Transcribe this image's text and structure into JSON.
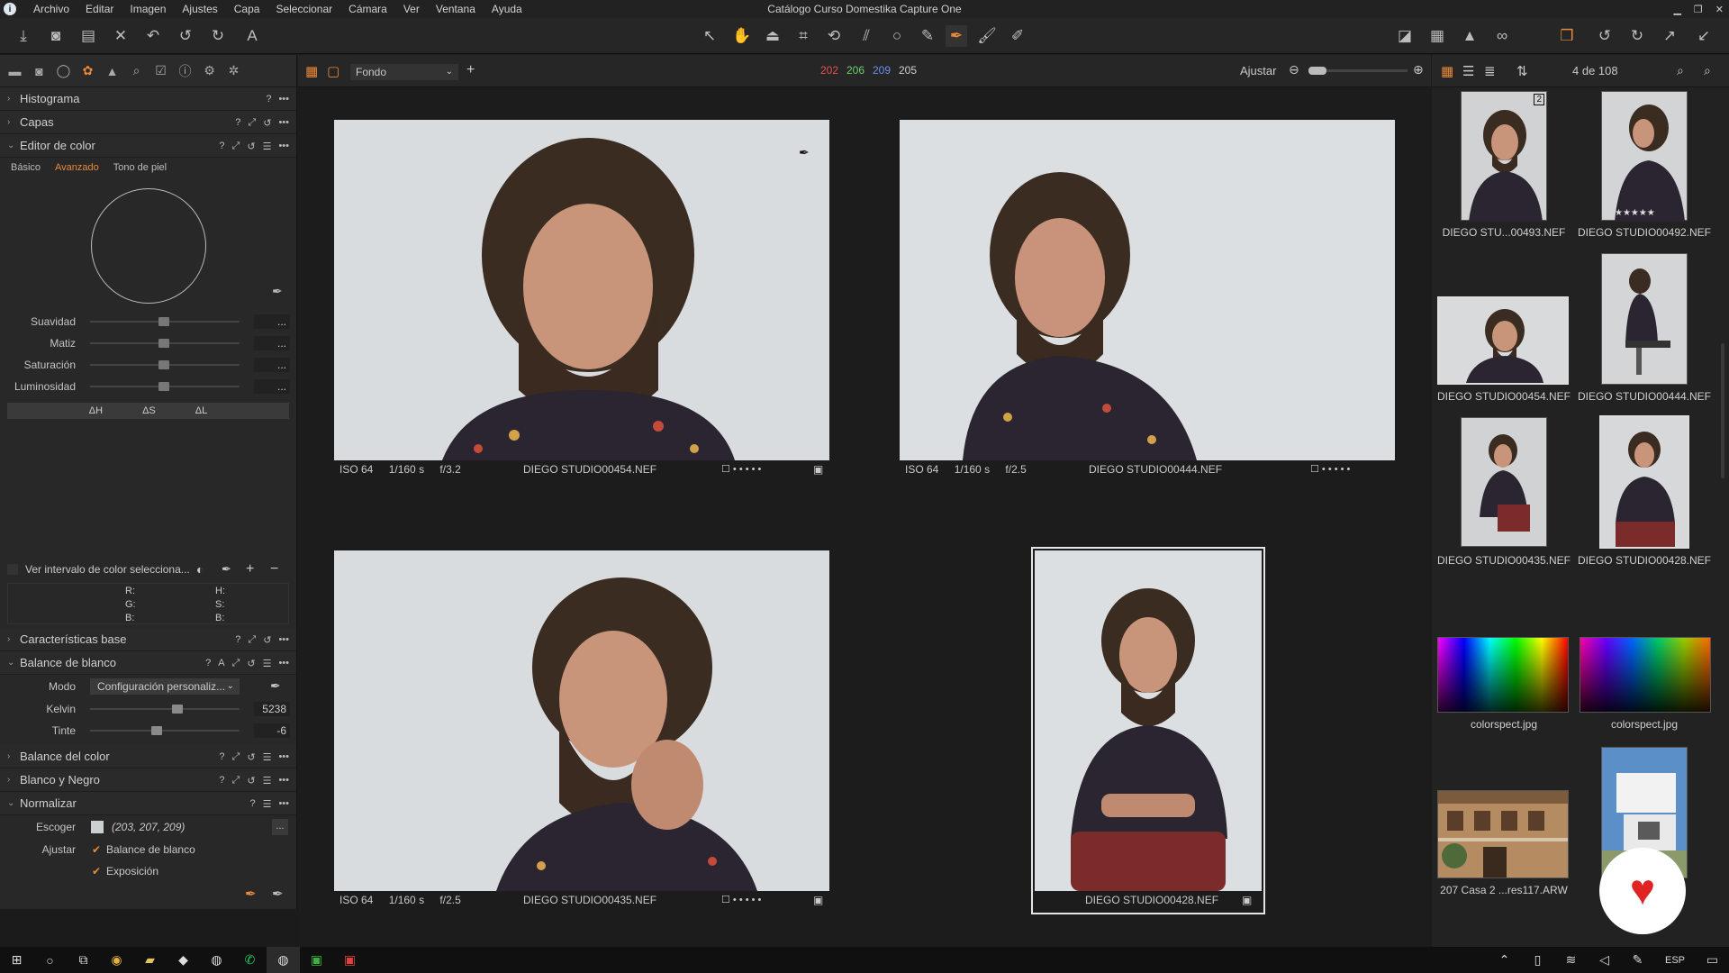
{
  "window": {
    "title": "Catálogo Curso Domestika Capture One"
  },
  "menu": [
    "Archivo",
    "Editar",
    "Imagen",
    "Ajustes",
    "Capa",
    "Seleccionar",
    "Cámara",
    "Ver",
    "Ventana",
    "Ayuda"
  ],
  "left_panel": {
    "sections_top": [
      {
        "label": "Histograma",
        "expanded": false
      },
      {
        "label": "Capas",
        "expanded": false
      },
      {
        "label": "Editor de color",
        "expanded": true
      }
    ],
    "color_editor": {
      "tabs": [
        "Básico",
        "Avanzado",
        "Tono de piel"
      ],
      "active_tab": "Avanzado",
      "sliders": [
        {
          "label": "Suavidad",
          "value": "..."
        },
        {
          "label": "Matiz",
          "value": "..."
        },
        {
          "label": "Saturación",
          "value": "..."
        },
        {
          "label": "Luminosidad",
          "value": "..."
        }
      ],
      "delta_buttons": [
        "ΔH",
        "ΔS",
        "ΔL"
      ],
      "view_range_label": "Ver intervalo de color selecciona...",
      "readout": {
        "r": "R:",
        "g": "G:",
        "b": "B:",
        "h": "H:",
        "s": "S:",
        "b2": "B:"
      }
    },
    "sections_mid": [
      {
        "label": "Características base",
        "expanded": false
      },
      {
        "label": "Balance de blanco",
        "expanded": true
      }
    ],
    "white_balance": {
      "mode_label": "Modo",
      "mode_value": "Configuración personaliz...",
      "kelvin_label": "Kelvin",
      "kelvin_value": "5238",
      "tint_label": "Tinte",
      "tint_value": "-6"
    },
    "sections_bottom": [
      {
        "label": "Balance del color",
        "expanded": false
      },
      {
        "label": "Blanco y Negro",
        "expanded": false
      },
      {
        "label": "Normalizar",
        "expanded": true
      }
    ],
    "normalize": {
      "pick_label": "Escoger",
      "pick_value": "(203, 207, 209)",
      "pick_btn": "...",
      "adjust_label": "Ajustar",
      "opt1": "Balance de blanco",
      "opt2": "Exposición"
    }
  },
  "center_bar": {
    "background_label": "Fondo",
    "rgb": {
      "r": "202",
      "g": "206",
      "b": "209",
      "l": "205"
    },
    "fit_label": "Ajustar"
  },
  "viewer": [
    {
      "iso": "ISO 64",
      "shutter": "1/160 s",
      "aperture": "f/3.2",
      "name": "DIEGO STUDIO00454.NEF"
    },
    {
      "iso": "ISO 64",
      "shutter": "1/160 s",
      "aperture": "f/2.5",
      "name": "DIEGO STUDIO00444.NEF"
    },
    {
      "iso": "ISO 64",
      "shutter": "1/160 s",
      "aperture": "f/2.5",
      "name": "DIEGO STUDIO00435.NEF"
    },
    {
      "iso": "",
      "shutter": "",
      "aperture": "",
      "name": "DIEGO STUDIO00428.NEF"
    }
  ],
  "browser": {
    "count": "4 de 108",
    "items": [
      {
        "name": "DIEGO STU...00493.NEF",
        "badge": "2"
      },
      {
        "name": "DIEGO STUDIO00492.NEF"
      },
      {
        "name": "DIEGO STUDIO00454.NEF"
      },
      {
        "name": "DIEGO STUDIO00444.NEF"
      },
      {
        "name": "DIEGO STUDIO00435.NEF"
      },
      {
        "name": "DIEGO STUDIO00428.NEF"
      },
      {
        "name": "colorspect.jpg"
      },
      {
        "name": "colorspect.jpg"
      },
      {
        "name": "207 Casa 2 ...res117.ARW"
      },
      {
        "name": ""
      }
    ]
  },
  "taskbar": {
    "lang": "ESP"
  },
  "colors": {
    "accent": "#e9893a",
    "red": "#e05252",
    "green": "#6bd06b",
    "blue": "#6f8ff0"
  }
}
